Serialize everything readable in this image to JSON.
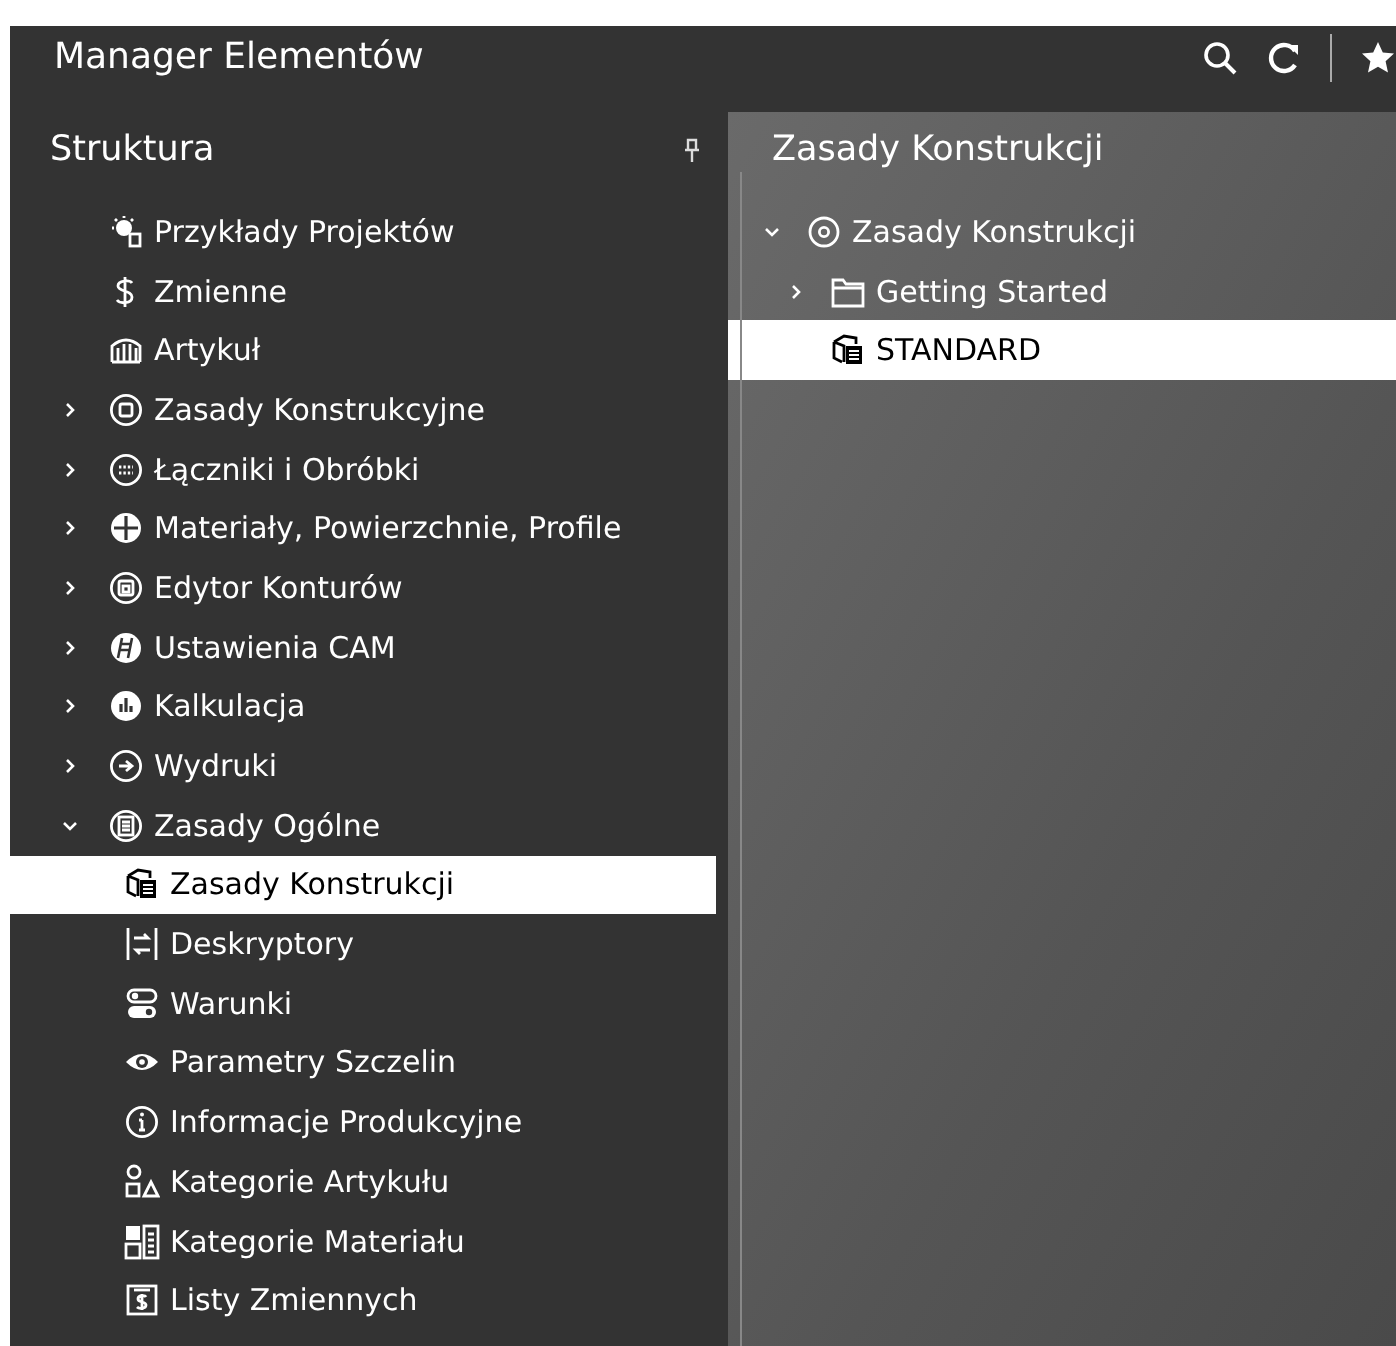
{
  "window": {
    "title": "Manager Elementów"
  },
  "structure_panel": {
    "title": "Struktura",
    "items": [
      {
        "label": "Przykłady Projektów",
        "selected": false
      },
      {
        "label": "Zmienne",
        "selected": false
      },
      {
        "label": "Artykuł",
        "selected": false
      },
      {
        "label": "Zasady Konstrukcyjne",
        "expanded": false,
        "selected": false
      },
      {
        "label": "Łączniki i Obróbki",
        "expanded": false,
        "selected": false
      },
      {
        "label": "Materiały, Powierzchnie, Profile",
        "expanded": false,
        "selected": false
      },
      {
        "label": "Edytor Konturów",
        "expanded": false,
        "selected": false
      },
      {
        "label": "Ustawienia CAM",
        "expanded": false,
        "selected": false
      },
      {
        "label": "Kalkulacja",
        "expanded": false,
        "selected": false
      },
      {
        "label": "Wydruki",
        "expanded": false,
        "selected": false
      },
      {
        "label": "Zasady Ogólne",
        "expanded": true,
        "selected": false,
        "children": [
          {
            "label": "Zasady Konstrukcji",
            "selected": true
          },
          {
            "label": "Deskryptory",
            "selected": false
          },
          {
            "label": "Warunki",
            "selected": false
          },
          {
            "label": "Parametry Szczelin",
            "selected": false
          },
          {
            "label": "Informacje Produkcyjne",
            "selected": false
          },
          {
            "label": "Kategorie Artykułu",
            "selected": false
          },
          {
            "label": "Kategorie Materiału",
            "selected": false
          },
          {
            "label": "Listy Zmiennych",
            "selected": false
          }
        ]
      }
    ]
  },
  "detail_panel": {
    "title": "Zasady Konstrukcji",
    "items": [
      {
        "label": "Zasady Konstrukcji",
        "expanded": true,
        "selected": false,
        "children": [
          {
            "label": "Getting Started",
            "expanded": false,
            "selected": false
          },
          {
            "label": "STANDARD",
            "selected": true
          }
        ]
      }
    ]
  }
}
